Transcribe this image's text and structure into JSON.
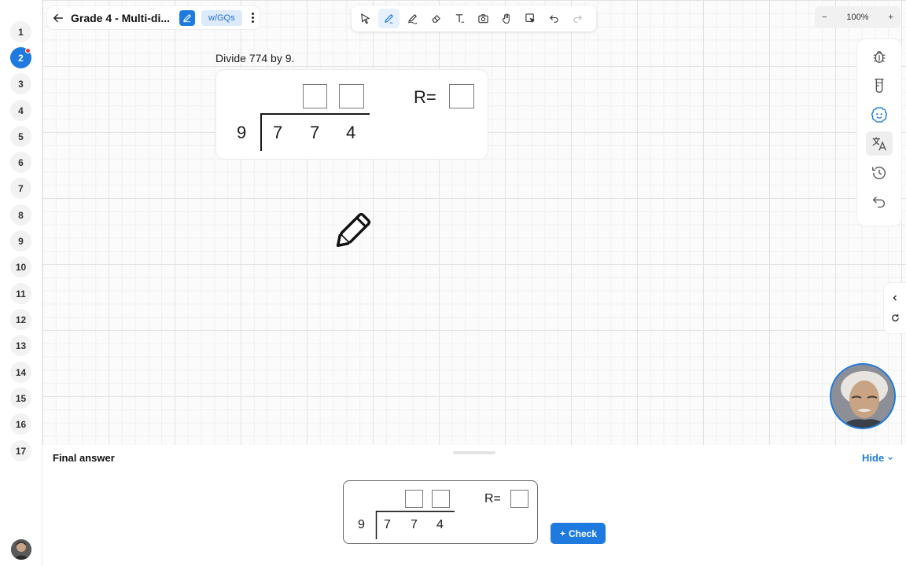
{
  "header": {
    "title": "Grade 4 - Multi-di...",
    "tag_label": "w/GQs"
  },
  "zoom": {
    "level": "100%",
    "minus": "−",
    "plus": "+"
  },
  "pages": {
    "items": [
      "1",
      "2",
      "3",
      "4",
      "5",
      "6",
      "7",
      "8",
      "9",
      "10",
      "11",
      "12",
      "13",
      "14",
      "15",
      "16",
      "17"
    ],
    "active": "2"
  },
  "toolbar": {
    "tools": [
      "select-icon",
      "pen-icon",
      "highlighter-icon",
      "eraser-icon",
      "text-icon",
      "camera-icon",
      "hand-icon",
      "screen-select-icon",
      "undo-icon",
      "redo-icon"
    ],
    "active_tool": "pen-icon"
  },
  "side_panel": {
    "buttons": [
      "bug-icon",
      "beaker-icon",
      "tutor-face-icon",
      "translate-icon",
      "history-icon",
      "undo-icon"
    ]
  },
  "problem": {
    "prompt": "Divide 774 by 9.",
    "divisor": "9",
    "dividend_digits": [
      "7",
      "7",
      "4"
    ],
    "remainder_label": "R="
  },
  "final_answer": {
    "label": "Final answer",
    "hide_label": "Hide",
    "divisor": "9",
    "dividend_digits": [
      "7",
      "7",
      "4"
    ],
    "remainder_label": "R=",
    "check_label": "Check"
  },
  "colors": {
    "accent": "#1f7ae0",
    "tag_bg": "#dceafb"
  }
}
